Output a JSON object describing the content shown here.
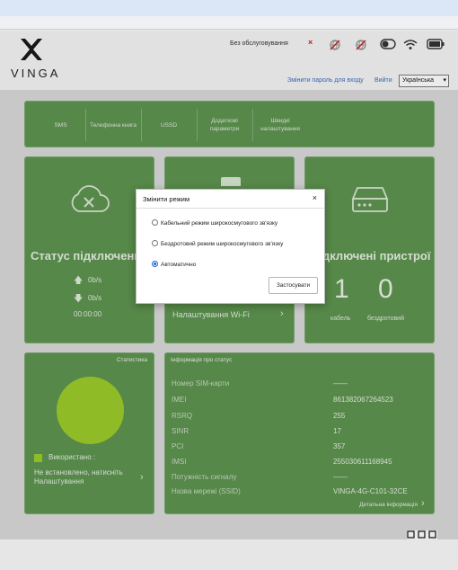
{
  "header": {
    "logo_text": "VINGA",
    "network_status": "Без обслуговування",
    "change_password": "Змінити пароль для входу",
    "login": "Вийти",
    "language": "Українська"
  },
  "menu": [
    {
      "label": "SMS"
    },
    {
      "label": "Телефонна книга"
    },
    {
      "label": "USSD"
    },
    {
      "label": "Додаткові параметри"
    },
    {
      "label": "Швидкі налаштування"
    }
  ],
  "connection": {
    "title": "Статус підключення",
    "up_rate": "0b/s",
    "down_rate": "0b/s",
    "duration": "00:00:00"
  },
  "wifi": {
    "settings_link": "Налаштування Wi-Fi"
  },
  "devices": {
    "title": "Підключені пристрої",
    "cable_count": "1",
    "wireless_count": "0",
    "cable_label": "кабель",
    "wireless_label": "бездротовий"
  },
  "stats": {
    "title": "Статистика",
    "used_label": "Використано   :",
    "not_installed": "Не встановлено, натисніть Налаштування"
  },
  "info": {
    "title": "Інформація про статус",
    "rows": [
      {
        "label": "Номер SIM-карти",
        "value": "——"
      },
      {
        "label": "IMEI",
        "value": "861382067264523"
      },
      {
        "label": "RSRQ",
        "value": "255"
      },
      {
        "label": "SINR",
        "value": "17"
      },
      {
        "label": "PCI",
        "value": "357"
      },
      {
        "label": "IMSI",
        "value": "255030611168945"
      },
      {
        "label": "Потужність сигналу",
        "value": "——"
      },
      {
        "label": "Назва мережі (SSID)",
        "value": "VINGA-4G-C101-32CE"
      }
    ],
    "detail_link": "Детальна інформація"
  },
  "modal": {
    "title": "Змінити режим",
    "close": "×",
    "options": [
      {
        "label": "Кабельний режим широкосмугового зв'язку",
        "selected": false
      },
      {
        "label": "Бездротовий режим широкосмугового зв'язку",
        "selected": false
      },
      {
        "label": "Автоматично",
        "selected": true
      }
    ],
    "apply": "Застосувати"
  },
  "colors": {
    "panel": "#5e9450",
    "accent_circle": "#9ccc2a",
    "link": "#3a6dbf",
    "error": "#d21f1f"
  }
}
